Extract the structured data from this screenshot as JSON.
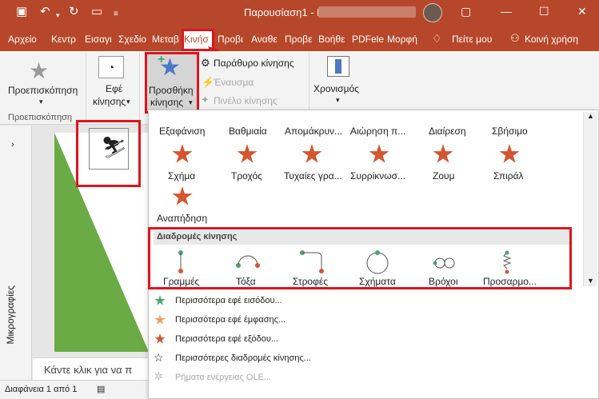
{
  "title": "Παρουσίαση1 - PowerPoint",
  "tabs": [
    "Αρχείο",
    "Κεντρ",
    "Εισαγι",
    "Σχεδίο",
    "Μεταβ",
    "Κινήσ",
    "Προβι",
    "Αναθε",
    "Προβε",
    "Βοήθε",
    "PDFele",
    "Μορφή",
    "Πείτε μου",
    "Κοινή χρήση"
  ],
  "ribbon": {
    "preview": "Προεπισκόπηση",
    "preview_group": "Προεπισκόπηση",
    "effects": "Εφέ",
    "effects2": "κίνησης",
    "add1": "Προσθήκη",
    "add2": "κίνησης",
    "pane": "Παράθυρο κίνησης",
    "trigger": "Έναυσμα",
    "painter": "Πινέλο κίνησης",
    "timing": "Χρονισμός"
  },
  "side": {
    "label": "Μικρογραφίες"
  },
  "notes": "Κάντε κλικ για να π",
  "status": {
    "slide": "Διαφάνεια 1 από 1"
  },
  "exit_row1": [
    "Εξαφάνιση",
    "Βαθμιαία",
    "Απομάκρυν...",
    "Αιώρηση π...",
    "Διαίρεση",
    "Σβήσιμο"
  ],
  "exit_row2": [
    "Σχήμα",
    "Τροχός",
    "Τυχαίες γρα...",
    "Συρρίκνωσ...",
    "Ζουμ",
    "Σπιράλ"
  ],
  "exit_row3": [
    "Αναπήδηση"
  ],
  "paths_title": "Διαδρομές κίνησης",
  "paths": [
    "Γραμμές",
    "Τόξα",
    "Στροφές",
    "Σχήματα",
    "Βρόχοι",
    "Προσαρμο..."
  ],
  "menu": [
    "Περισσότερα εφέ εισόδου...",
    "Περισσότερα εφέ έμφασης...",
    "Περισσότερα εφέ εξόδου...",
    "Περισσότερες διαδρομές κίνησης...",
    "Ρήματα ενέργειας OLE..."
  ],
  "colors": {
    "accent": "#b7472a",
    "entrance": "#4aa56e",
    "emphasis": "#f0a060",
    "exit": "#d4552e",
    "highlight": "#e0141e"
  }
}
